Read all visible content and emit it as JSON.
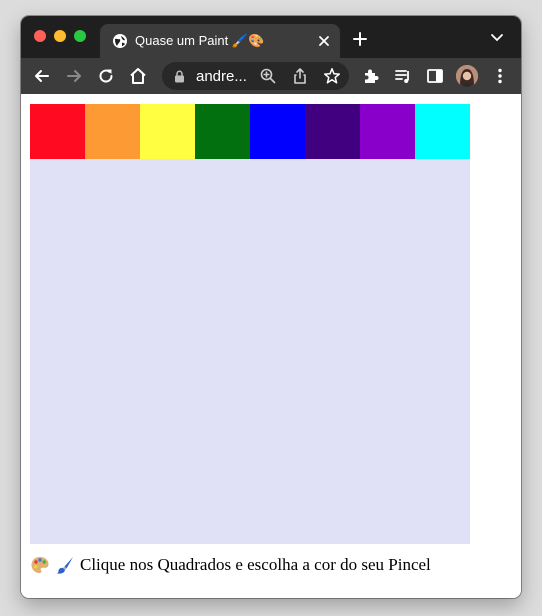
{
  "browser": {
    "tab_title": "Quase um Paint 🖌️🎨",
    "url_display": "andre...",
    "icons": [
      "globe-icon",
      "close-icon",
      "plus-icon",
      "chevron-down-icon",
      "back-icon",
      "forward-icon",
      "reload-icon",
      "home-icon",
      "lock-icon",
      "zoom-icon",
      "share-icon",
      "star-icon",
      "extensions-icon",
      "media-icon",
      "side-panel-icon",
      "profile-avatar",
      "kebab-menu-icon"
    ]
  },
  "palette": {
    "colors": [
      "#ff0a21",
      "#fe9a34",
      "#fffe40",
      "#02700f",
      "#0100fe",
      "#400080",
      "#8a00cb",
      "#00fffe"
    ]
  },
  "board": {
    "background": "#e0e1f7"
  },
  "caption": {
    "text": "Clique nos Quadrados e escolha a cor do seu Pincel",
    "icons": [
      "palette-icon",
      "paintbrush-icon"
    ]
  }
}
